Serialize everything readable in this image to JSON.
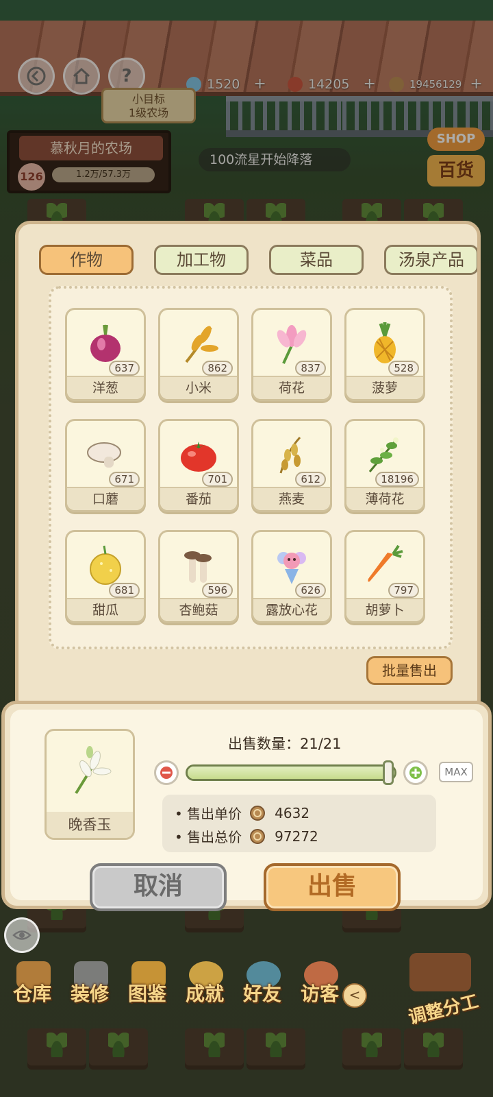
{
  "hud": {
    "resources": [
      {
        "value": "1520",
        "icon": "blue-gem-icon",
        "color": "#7fc3e6"
      },
      {
        "value": "14205",
        "icon": "red-gem-icon",
        "color": "#c6513c"
      },
      {
        "value": "19456129",
        "icon": "coin-icon",
        "color": "#b88a52"
      }
    ],
    "plus": "+",
    "help": "?",
    "goal": {
      "line1": "小目标",
      "line2": "1级农场"
    },
    "farm": {
      "name": "慕秋月的农场",
      "level": "126",
      "progress": "1.2万/57.3万"
    },
    "meteor": "100流星开始降落",
    "shop": {
      "top": "SHOP",
      "bottom": "百货"
    }
  },
  "tabs": [
    {
      "label": "作物",
      "active": true
    },
    {
      "label": "加工物",
      "active": false
    },
    {
      "label": "菜品",
      "active": false
    },
    {
      "label": "汤泉产品",
      "active": false
    }
  ],
  "items": [
    {
      "name": "洋葱",
      "count": "637",
      "icon": "onion-icon"
    },
    {
      "name": "小米",
      "count": "862",
      "icon": "millet-icon"
    },
    {
      "name": "荷花",
      "count": "837",
      "icon": "lotus-icon"
    },
    {
      "name": "菠萝",
      "count": "528",
      "icon": "pineapple-icon"
    },
    {
      "name": "口蘑",
      "count": "671",
      "icon": "mushroom-icon"
    },
    {
      "name": "番茄",
      "count": "701",
      "icon": "tomato-icon"
    },
    {
      "name": "燕麦",
      "count": "612",
      "icon": "oat-icon"
    },
    {
      "name": "薄荷花",
      "count": "18196",
      "icon": "mint-flower-icon"
    },
    {
      "name": "甜瓜",
      "count": "681",
      "icon": "melon-icon"
    },
    {
      "name": "杏鲍菇",
      "count": "596",
      "icon": "king-oyster-mushroom-icon"
    },
    {
      "name": "露放心花",
      "count": "626",
      "icon": "bouquet-icon"
    },
    {
      "name": "胡萝卜",
      "count": "797",
      "icon": "carrot-icon"
    }
  ],
  "batch_sell": "批量售出",
  "sell": {
    "selected": {
      "name": "晚香玉",
      "icon": "tuberose-icon"
    },
    "quantity_label": "出售数量：21/21",
    "quantity_fraction": 1.0,
    "max": "MAX",
    "unit_price_label": "• 售出单价",
    "unit_price": "4632",
    "total_price_label": "• 售出总价",
    "total_price": "97272",
    "cancel": "取消",
    "confirm": "出售"
  },
  "nav": [
    {
      "label": "仓库",
      "icon": "warehouse-icon"
    },
    {
      "label": "装修",
      "icon": "hammer-icon"
    },
    {
      "label": "图鉴",
      "icon": "book-icon"
    },
    {
      "label": "成就",
      "icon": "trophy-icon"
    },
    {
      "label": "好友",
      "icon": "friends-icon"
    },
    {
      "label": "访客",
      "icon": "phone-icon"
    }
  ],
  "nav_collapse": "<",
  "adjust": "调整分工"
}
